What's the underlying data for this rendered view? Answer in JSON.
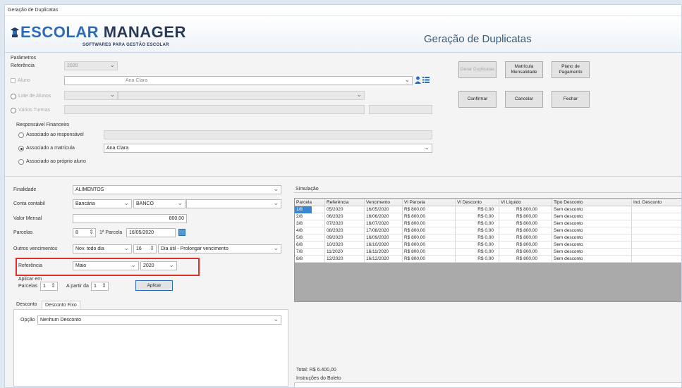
{
  "window": {
    "title": "Geração de Duplicatas"
  },
  "header": {
    "logo_part1": "ESCOL",
    "logo_part2": "AR",
    "logo_part3": " MANAGER",
    "logo_sub": "SOFTWARES PARA GESTÃO ESCOLAR",
    "page_title": "Geração de Duplicatas"
  },
  "filters": {
    "group_label": "Parâmetros",
    "referencia_label": "Referência",
    "referencia_value": "2020",
    "aluno_label": "Aluno",
    "aluno_value": "Ana Clara",
    "lote_label": "Lote de Alunos",
    "multi_label": "Vários Turmas"
  },
  "responsavel": {
    "label": "Responsável Financeiro",
    "opt1": "Associado ao responsável",
    "opt2": "Associado a matrícula",
    "opt2_value": "Ana Clara",
    "opt3": "Associado ao próprio aluno"
  },
  "buttons": {
    "gerar": "Gerar Duplicatas",
    "matricula": "Matrícula Mensalidade",
    "plano": "Plano de Pagamento",
    "confirmar": "Confirmar",
    "cancelar": "Cancelar",
    "fechar": "Fechar",
    "aplicar": "Aplicar"
  },
  "form": {
    "finalidade_label": "Finalidade",
    "finalidade_value": "ALIMENTOS",
    "conta_label": "Conta contabil",
    "conta_type": "Bancária",
    "conta_value": "BANCO",
    "valor_label": "Valor Mensal",
    "valor_value": "800,00",
    "parcelas_label": "Parcelas",
    "parcelas_value": "8",
    "primeira_label": "1ª Parcela",
    "primeira_value": "16/05/2020",
    "outros_label": "Outros vencimentos",
    "outros_value": "Nov. todo dia",
    "outros_day": "16",
    "outros_extra": "Dia útil - Prolongar vencimento",
    "ref_label": "Referência",
    "ref_month": "Maio",
    "ref_year": "2020",
    "aplicar_em": "Aplicar em",
    "parcelas2_label": "Parcelas",
    "parcelas2_value": "1",
    "apartir_label": "A partir da",
    "apartir_value": "1",
    "desconto_tab1": "Desconto",
    "desconto_tab2": "Desconto Fixo",
    "opcao_label": "Opção",
    "opcao_value": "Nenhum Desconto"
  },
  "simulacao": {
    "label": "Simulação",
    "columns": [
      "Parcela",
      "Referência",
      "Vencimento",
      "Vl Parcela",
      "Vl Desconto",
      "Vl Líquido",
      "Tipo Desconto",
      "Ind. Desconto"
    ],
    "rows": [
      [
        "1/8",
        "05/2020",
        "16/05/2020",
        "R$ 800,00",
        "R$ 0,00",
        "R$ 800,00",
        "Sem desconto",
        ""
      ],
      [
        "2/8",
        "06/2020",
        "16/06/2020",
        "R$ 800,00",
        "R$ 0,00",
        "R$ 800,00",
        "Sem desconto",
        ""
      ],
      [
        "3/8",
        "07/2020",
        "16/07/2020",
        "R$ 800,00",
        "R$ 0,00",
        "R$ 800,00",
        "Sem desconto",
        ""
      ],
      [
        "4/8",
        "08/2020",
        "17/08/2020",
        "R$ 800,00",
        "R$ 0,00",
        "R$ 800,00",
        "Sem desconto",
        ""
      ],
      [
        "5/8",
        "09/2020",
        "16/09/2020",
        "R$ 800,00",
        "R$ 0,00",
        "R$ 800,00",
        "Sem desconto",
        ""
      ],
      [
        "6/8",
        "10/2020",
        "16/10/2020",
        "R$ 800,00",
        "R$ 0,00",
        "R$ 800,00",
        "Sem desconto",
        ""
      ],
      [
        "7/8",
        "11/2020",
        "16/11/2020",
        "R$ 800,00",
        "R$ 0,00",
        "R$ 800,00",
        "Sem desconto",
        ""
      ],
      [
        "8/8",
        "12/2020",
        "16/12/2020",
        "R$ 800,00",
        "R$ 0,00",
        "R$ 800,00",
        "Sem desconto",
        ""
      ]
    ],
    "total": "Total: R$ 6.400,00",
    "instrucoes": "Instruções do Boleto"
  },
  "colors": {
    "accent": "#2d6bb7",
    "selection": "#3a86d1",
    "highlight": "#e0302a"
  }
}
